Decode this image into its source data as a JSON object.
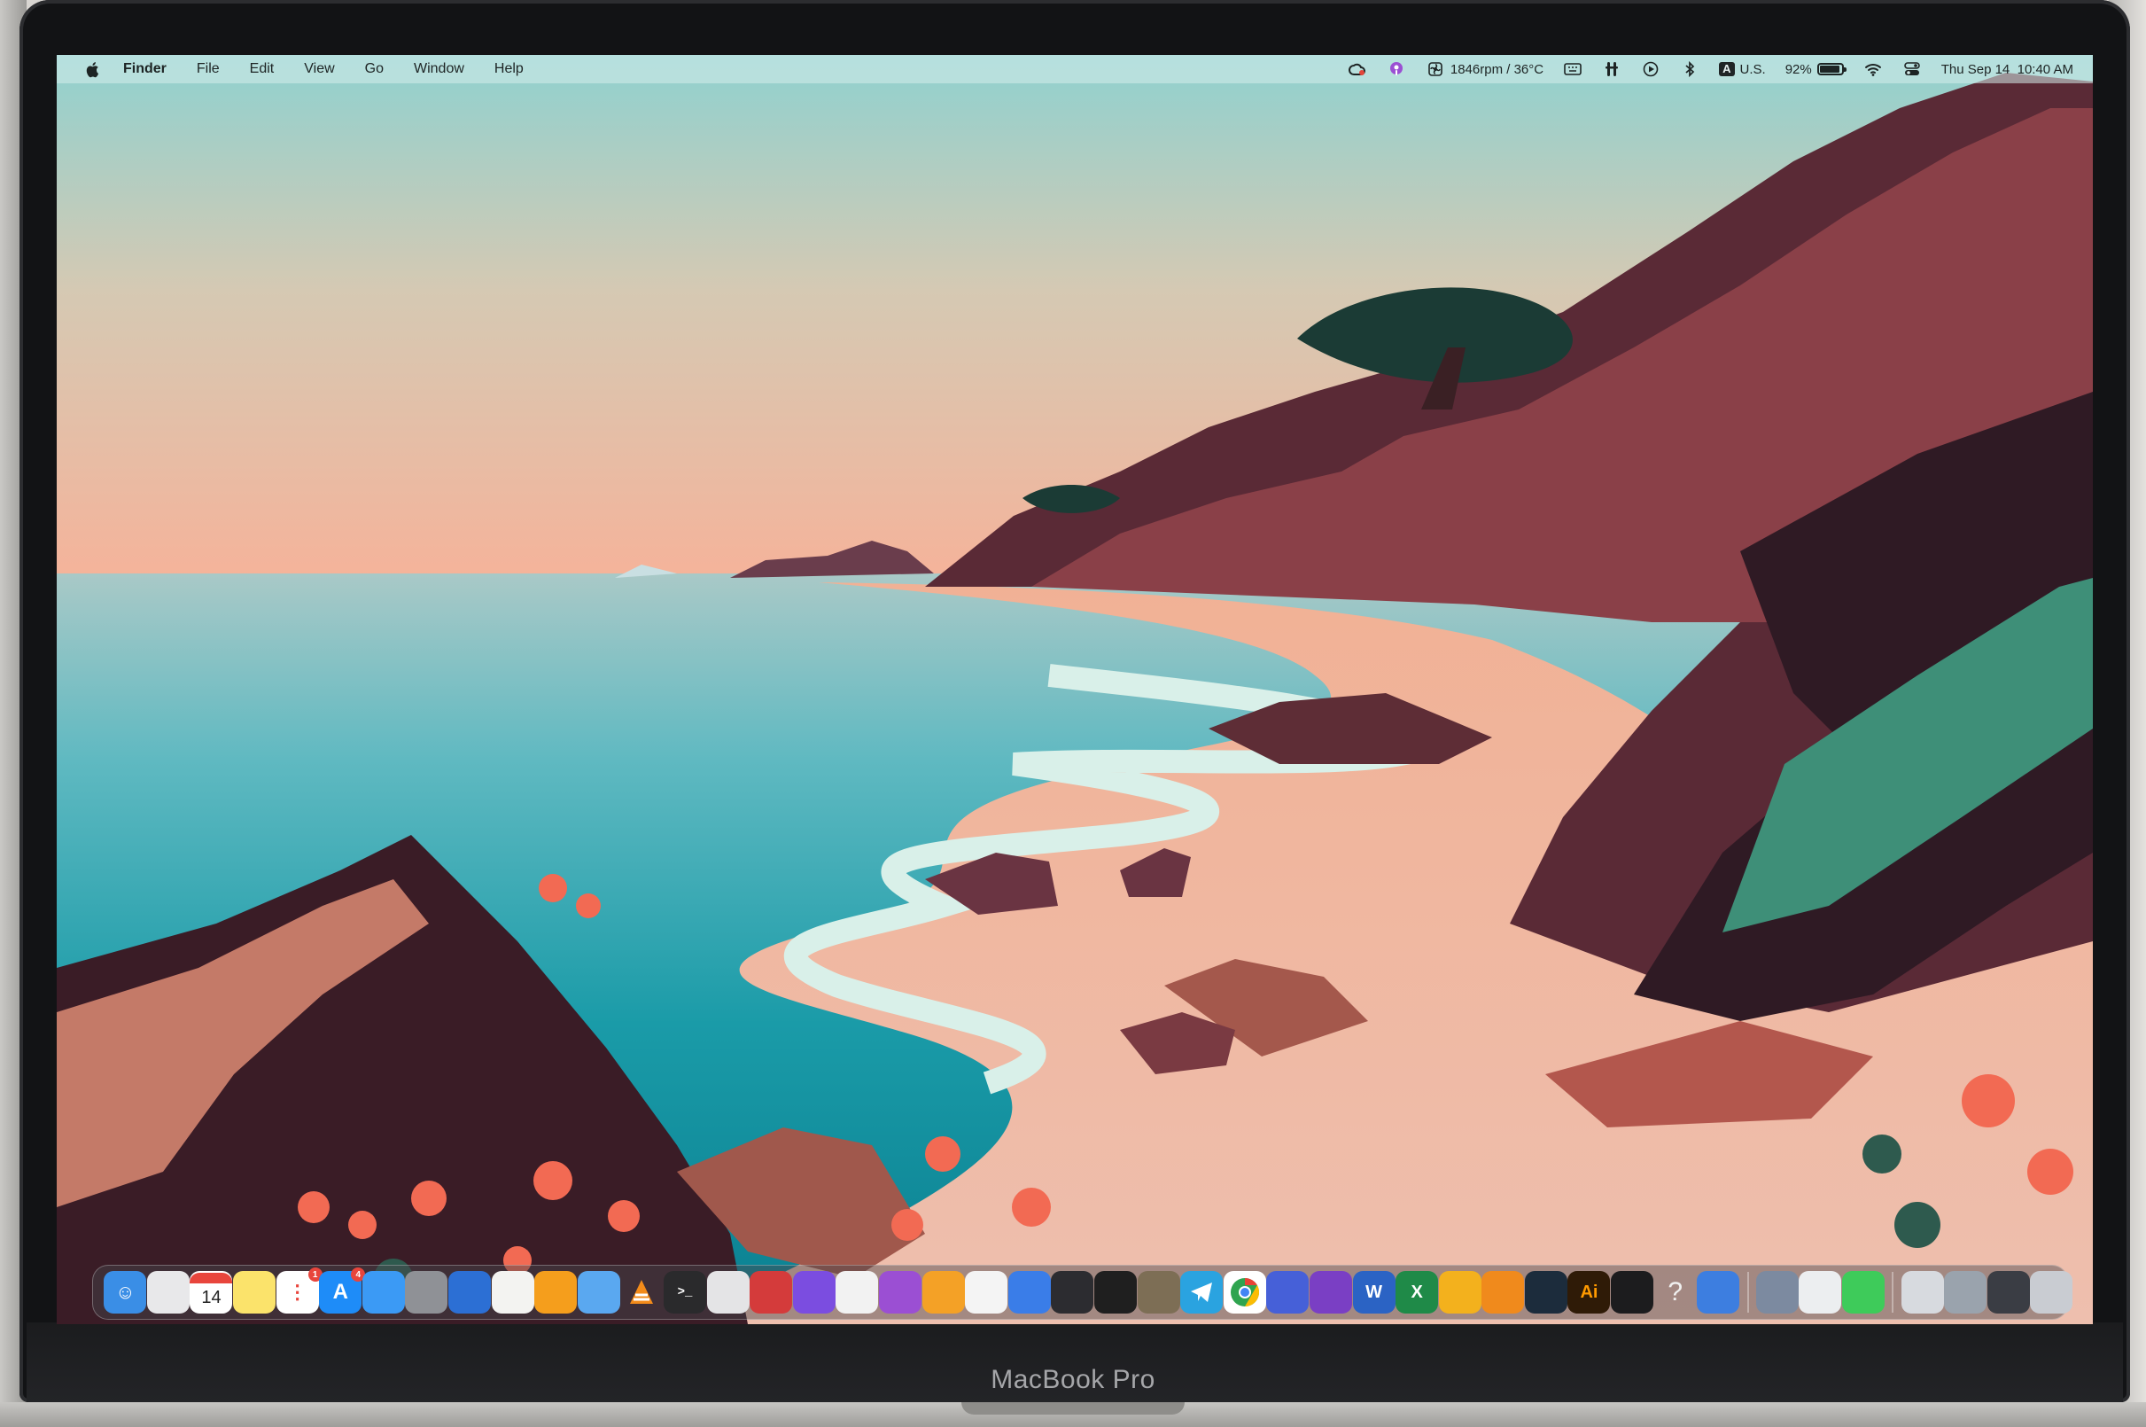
{
  "device": {
    "brand_label": "MacBook Pro"
  },
  "menubar": {
    "app_name": "Finder",
    "menus": [
      "File",
      "Edit",
      "View",
      "Go",
      "Window",
      "Help"
    ],
    "fan_readout": "1846rpm / 36°C",
    "input_source_badge": "A",
    "input_source_label": "U.S.",
    "battery_percent": "92%",
    "battery_level": 0.92,
    "datetime": "Thu Sep 14  10:40 AM",
    "status_icons": [
      "creative-cloud-icon",
      "podcast-icon",
      "fan-icon",
      "keyboard-brightness-icon",
      "accessibility-icon",
      "play-icon",
      "bluetooth-icon",
      "wifi-icon",
      "control-center-icon"
    ]
  },
  "dock": {
    "calendar_day": "14",
    "appstore_badge": "4",
    "reminders_badge": "1",
    "illustrator_label": "Ai",
    "help_glyph": "?",
    "apps": [
      {
        "name": "finder",
        "color": "#3a8ee6"
      },
      {
        "name": "launchpad",
        "color": "#e8e8ea"
      },
      {
        "name": "calendar",
        "color": "#ffffff"
      },
      {
        "name": "notes",
        "color": "#fbe36b"
      },
      {
        "name": "reminders",
        "color": "#ffffff"
      },
      {
        "name": "app-store",
        "color": "#1e8cf8"
      },
      {
        "name": "mail",
        "color": "#3b9af5"
      },
      {
        "name": "system-settings",
        "color": "#8f9196"
      },
      {
        "name": "wave-app",
        "color": "#2c6fd4"
      },
      {
        "name": "textedit",
        "color": "#f3f3f1"
      },
      {
        "name": "reeder",
        "color": "#f59e1c"
      },
      {
        "name": "preview",
        "color": "#5aa8f0"
      },
      {
        "name": "vlc",
        "color": "#f38b1a"
      },
      {
        "name": "terminal",
        "color": "#2a2a2c"
      },
      {
        "name": "calculator",
        "color": "#e4e4e6"
      },
      {
        "name": "davinci",
        "color": "#d43b3b"
      },
      {
        "name": "files-purple",
        "color": "#7b4de0"
      },
      {
        "name": "messages-white",
        "color": "#f2f2f2"
      },
      {
        "name": "podcasts",
        "color": "#9b4fd3"
      },
      {
        "name": "m-app",
        "color": "#f4a126"
      },
      {
        "name": "notion-like",
        "color": "#f4f4f4"
      },
      {
        "name": "document-blue",
        "color": "#3a7de8"
      },
      {
        "name": "pen-tool",
        "color": "#2c2c30"
      },
      {
        "name": "inkscape",
        "color": "#1f1f1f"
      },
      {
        "name": "gimp",
        "color": "#7d6e55"
      },
      {
        "name": "telegram",
        "color": "#2aa3e0"
      },
      {
        "name": "chrome",
        "color": "#ffffff"
      },
      {
        "name": "print-blue",
        "color": "#4660d8"
      },
      {
        "name": "onenote-purple",
        "color": "#7a3fc4"
      },
      {
        "name": "word",
        "color": "#2b63c4"
      },
      {
        "name": "excel",
        "color": "#1f8a48"
      },
      {
        "name": "sunflower",
        "color": "#f3b11d"
      },
      {
        "name": "blender",
        "color": "#f08a1c"
      },
      {
        "name": "steam-globe",
        "color": "#1c2c3c"
      },
      {
        "name": "illustrator",
        "color": "#2f1b07"
      },
      {
        "name": "console",
        "color": "#1c1c1e"
      },
      {
        "name": "help",
        "color": "transparent"
      },
      {
        "name": "cloud-app",
        "color": "#3d7ee0"
      }
    ],
    "recent": [
      {
        "name": "disk-utility",
        "color": "#7c8aa0"
      },
      {
        "name": "home-app",
        "color": "#eceef0"
      },
      {
        "name": "facetime",
        "color": "#3ecb5a"
      }
    ],
    "minimized": [
      {
        "name": "window-thumb-1",
        "color": "#d7dadf"
      },
      {
        "name": "window-thumb-2",
        "color": "#9aa3ad"
      },
      {
        "name": "window-thumb-3",
        "color": "#3a3d44"
      },
      {
        "name": "trash",
        "color": "#c9ccd2"
      }
    ]
  }
}
